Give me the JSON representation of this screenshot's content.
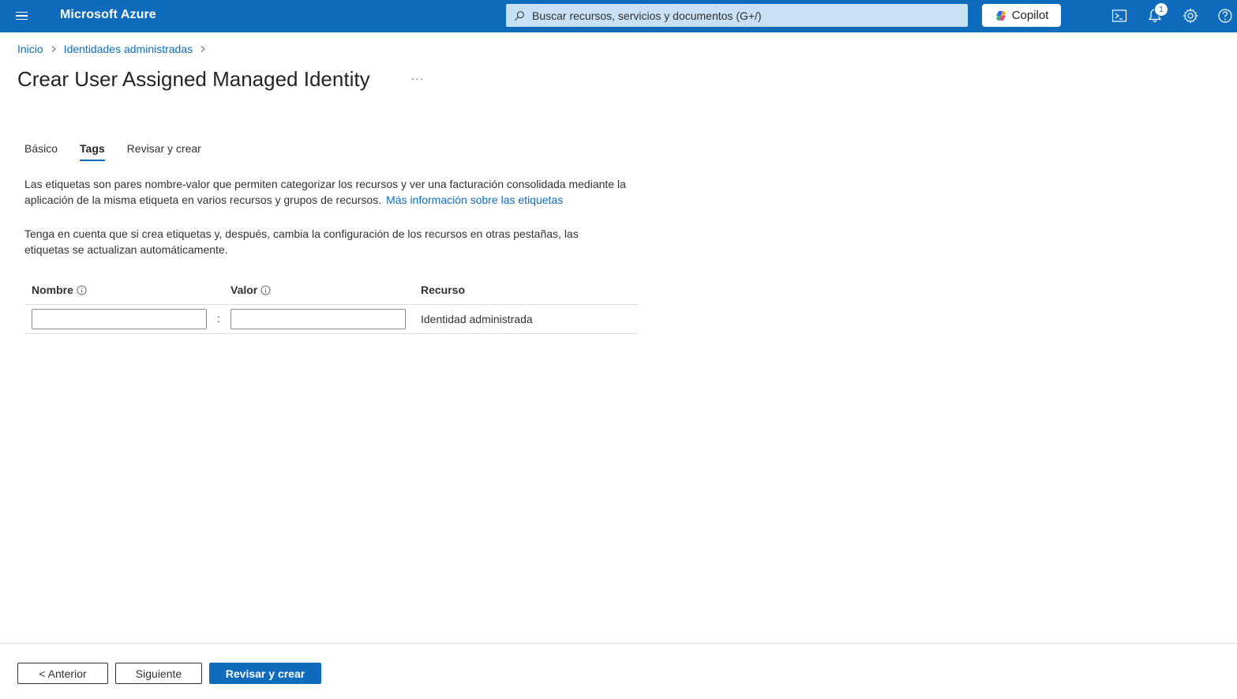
{
  "topbar": {
    "brand": "Microsoft Azure",
    "search_placeholder": "Buscar recursos, servicios y documentos (G+/)",
    "copilot_label": "Copilot",
    "notification_count": "1",
    "colors": {
      "bar": "#0f6cbd",
      "search_bg": "#c7e0f4"
    }
  },
  "breadcrumb": {
    "items": [
      "Inicio",
      "Identidades administradas"
    ]
  },
  "page": {
    "title": "Crear User Assigned Managed Identity",
    "more_label": "···"
  },
  "tabs": [
    {
      "label": "Básico",
      "active": false
    },
    {
      "label": "Tags",
      "active": true
    },
    {
      "label": "Revisar y crear",
      "active": false
    }
  ],
  "intro": {
    "text": "Las etiquetas son pares nombre-valor que permiten categorizar los recursos y ver una facturación consolidada mediante la aplicación de la misma etiqueta en varios recursos y grupos de recursos.",
    "link": "Más información sobre las etiquetas"
  },
  "note": {
    "text": "Tenga en cuenta que si crea etiquetas y, después, cambia la configuración de los recursos en otras pestañas, las etiquetas se actualizan automáticamente."
  },
  "tag_table": {
    "headers": {
      "name": "Nombre",
      "value": "Valor",
      "resource": "Recurso"
    },
    "rows": [
      {
        "name": "",
        "value": "",
        "separator": ":",
        "resource": "Identidad administrada"
      }
    ]
  },
  "footer": {
    "previous": "< Anterior",
    "next": "Siguiente",
    "review": "Revisar y crear"
  }
}
